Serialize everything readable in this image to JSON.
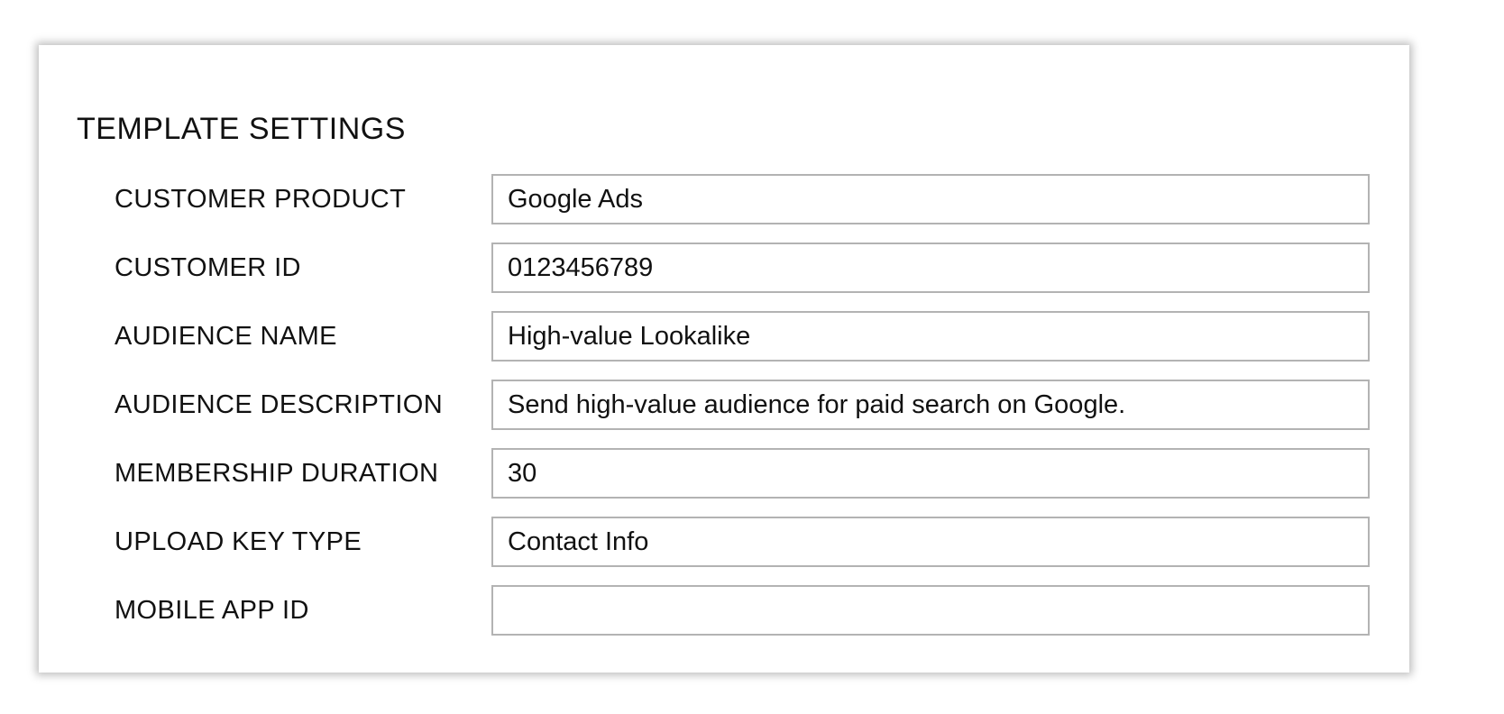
{
  "panel": {
    "title": "TEMPLATE SETTINGS",
    "fields": [
      {
        "label": "CUSTOMER PRODUCT",
        "value": "Google Ads"
      },
      {
        "label": "CUSTOMER ID",
        "value": "0123456789"
      },
      {
        "label": "AUDIENCE NAME",
        "value": "High-value Lookalike"
      },
      {
        "label": "AUDIENCE DESCRIPTION",
        "value": "Send high-value audience for paid search on Google."
      },
      {
        "label": "MEMBERSHIP DURATION",
        "value": "30"
      },
      {
        "label": "UPLOAD KEY TYPE",
        "value": "Contact Info"
      },
      {
        "label": "MOBILE APP ID",
        "value": ""
      }
    ]
  }
}
